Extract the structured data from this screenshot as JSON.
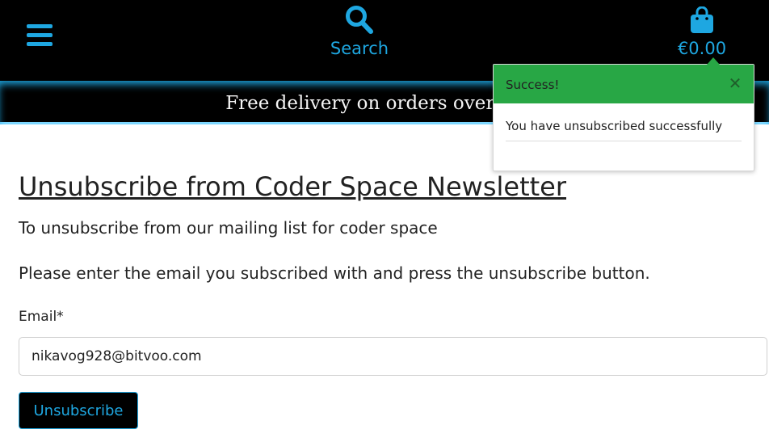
{
  "header": {
    "search_label": "Search",
    "bag_total": "€0.00",
    "icons": {
      "menu": "hamburger-menu-icon",
      "search": "search-icon",
      "bag": "shopping-bag-icon"
    },
    "accent_color": "#1ea7e1"
  },
  "banner": {
    "text": "Free delivery on orders over €50!"
  },
  "toast": {
    "title": "Success!",
    "close_symbol": "✕",
    "message": "You have unsubscribed successfully",
    "header_color": "#28a745"
  },
  "main": {
    "title": "Unsubscribe from Coder Space Newsletter",
    "lead": "To unsubscribe from our mailing list for coder space",
    "instruction": "Please enter the email you subscribed with and press the unsubscribe button.",
    "form": {
      "email_label": "Email*",
      "email_value": "nikavog928@bitvoo.com",
      "submit_label": "Unsubscribe"
    }
  }
}
